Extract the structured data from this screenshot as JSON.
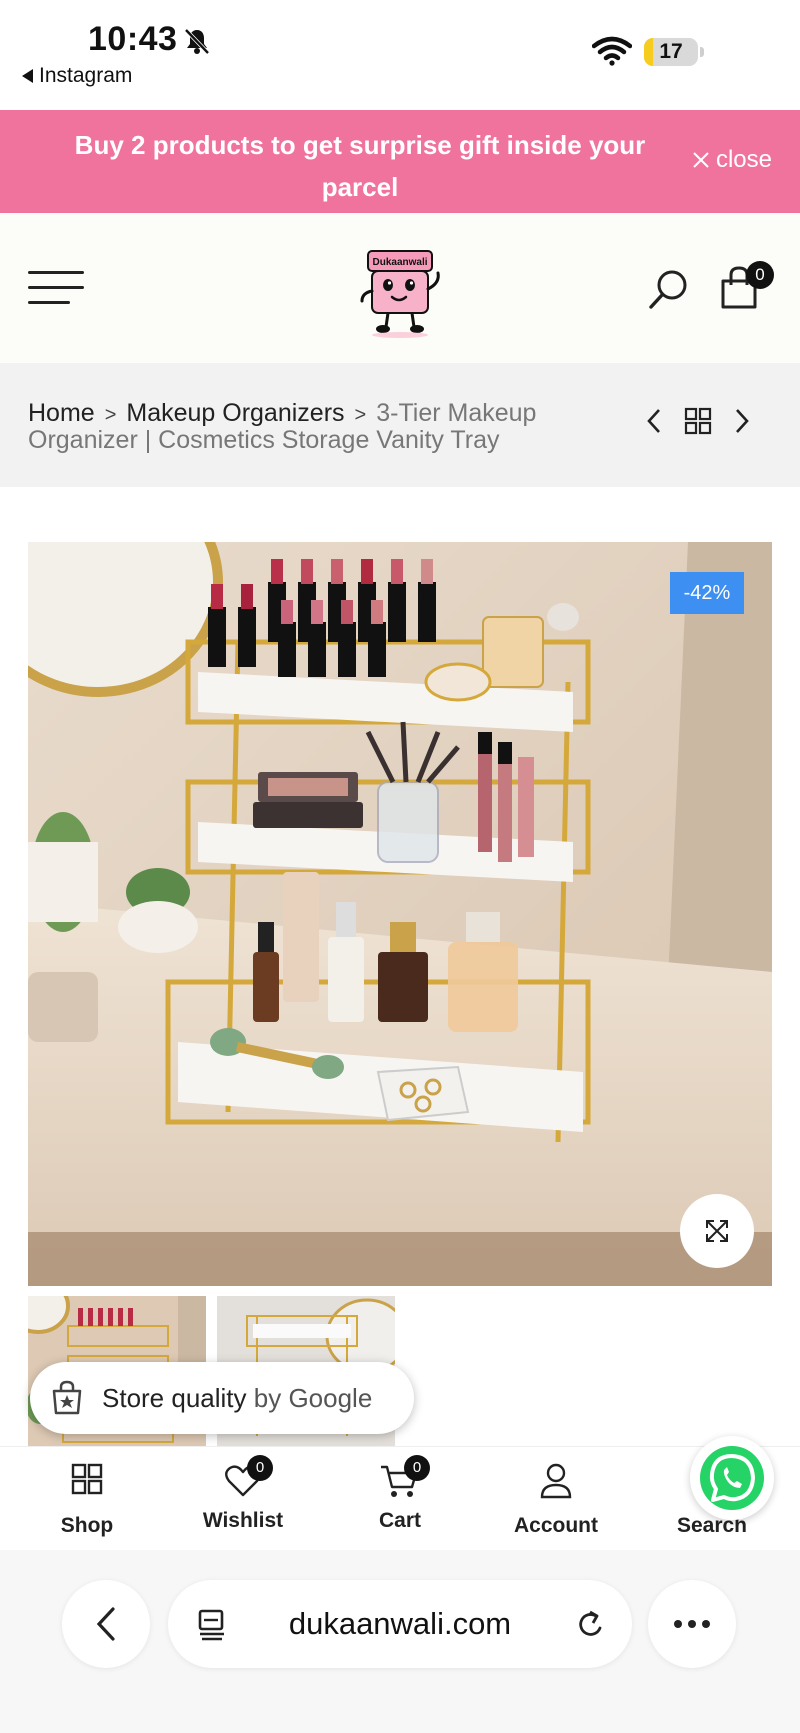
{
  "status_bar": {
    "time": "10:43",
    "back_app": "Instagram",
    "battery": 17
  },
  "promo": {
    "text": "Buy 2 products to get surprise gift inside your parcel",
    "close_label": "close"
  },
  "header": {
    "logo_text": "Dukaanwali",
    "cart_count": "0"
  },
  "breadcrumb": {
    "home": "Home",
    "category": "Makeup Organizers",
    "current": "3-Tier Makeup Organizer | Cosmetics Storage Vanity Tray"
  },
  "product": {
    "discount_badge": "-42%"
  },
  "google_badge": {
    "text_main": "Store quality",
    "text_by": "by Google"
  },
  "bottom_nav": {
    "items": [
      {
        "label": "Shop",
        "icon": "grid-icon"
      },
      {
        "label": "Wishlist",
        "icon": "heart-icon",
        "count": "0"
      },
      {
        "label": "Cart",
        "icon": "cart-icon",
        "count": "0"
      },
      {
        "label": "Account",
        "icon": "user-icon"
      },
      {
        "label": "Search",
        "icon": "search-icon"
      }
    ]
  },
  "browser": {
    "url": "dukaanwali.com"
  },
  "colors": {
    "promo_bg": "#f0739d",
    "discount_bg": "#3d8ff1",
    "whatsapp": "#25d366"
  }
}
